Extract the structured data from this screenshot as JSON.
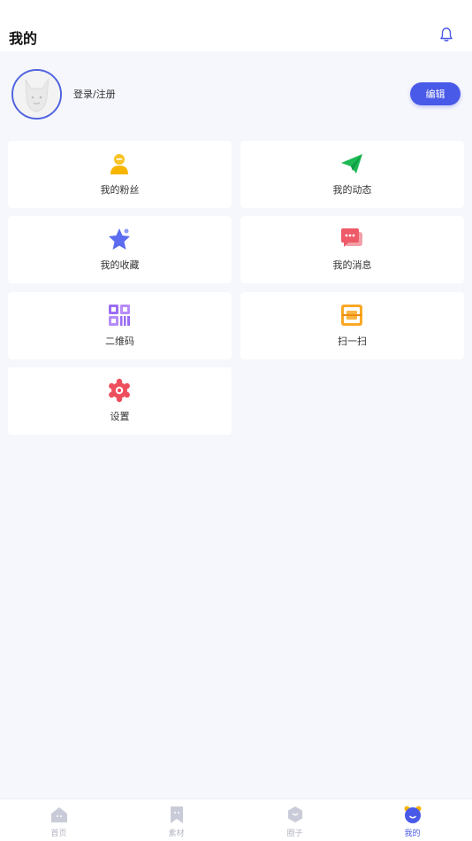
{
  "header": {
    "title": "我的"
  },
  "profile": {
    "login_label": "登录/注册",
    "edit_label": "编辑"
  },
  "menu": [
    {
      "label": "我的粉丝",
      "icon": "fans-icon"
    },
    {
      "label": "我的动态",
      "icon": "paper-plane-icon"
    },
    {
      "label": "我的收藏",
      "icon": "star-icon"
    },
    {
      "label": "我的消息",
      "icon": "message-icon"
    },
    {
      "label": "二维码",
      "icon": "qrcode-icon"
    },
    {
      "label": "扫一扫",
      "icon": "scan-icon"
    },
    {
      "label": "设置",
      "icon": "gear-icon"
    }
  ],
  "tabs": [
    {
      "label": "首页",
      "icon": "home-icon",
      "active": false
    },
    {
      "label": "素材",
      "icon": "material-icon",
      "active": false
    },
    {
      "label": "圈子",
      "icon": "circle-icon",
      "active": false
    },
    {
      "label": "我的",
      "icon": "mine-icon",
      "active": true
    }
  ],
  "colors": {
    "accent": "#4a5ae8",
    "background": "#f6f7fc",
    "inactive_tab": "#b3b6c4"
  }
}
